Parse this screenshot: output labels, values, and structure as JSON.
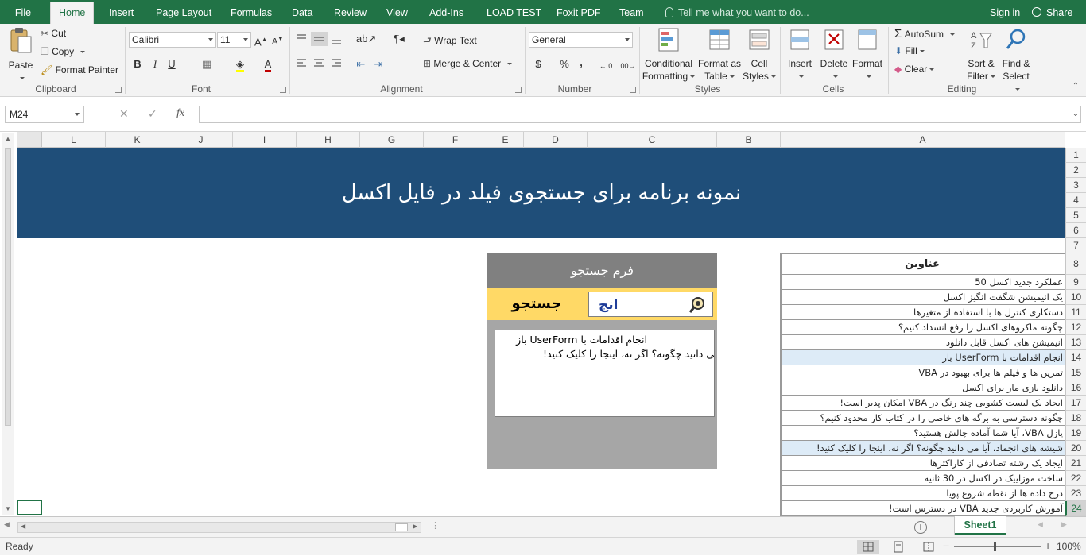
{
  "ribbon_tabs": [
    "File",
    "Home",
    "Insert",
    "Page Layout",
    "Formulas",
    "Data",
    "Review",
    "View",
    "Add-Ins",
    "LOAD TEST",
    "Foxit PDF",
    "Team"
  ],
  "tell_me": "Tell me what you want to do...",
  "sign_in": "Sign in",
  "share": "Share",
  "clipboard": {
    "paste": "Paste",
    "cut": "Cut",
    "copy": "Copy",
    "format_painter": "Format Painter",
    "label": "Clipboard"
  },
  "font": {
    "name": "Calibri",
    "size": "11",
    "bold": "B",
    "italic": "I",
    "underline": "U",
    "label": "Font"
  },
  "alignment": {
    "wrap_text": "Wrap Text",
    "merge_center": "Merge & Center",
    "label": "Alignment"
  },
  "number": {
    "format": "General",
    "currency": "$",
    "percent": "%",
    "comma": ",",
    "label": "Number"
  },
  "styles": {
    "conditional_formatting": [
      "Conditional",
      "Formatting"
    ],
    "format_as_table": [
      "Format as",
      "Table"
    ],
    "cell_styles": [
      "Cell",
      "Styles"
    ],
    "label": "Styles"
  },
  "cells": {
    "insert": "Insert",
    "delete": "Delete",
    "format": "Format",
    "label": "Cells"
  },
  "editing": {
    "autosum": "AutoSum",
    "fill": "Fill",
    "clear": "Clear",
    "sort_filter": [
      "Sort &",
      "Filter"
    ],
    "find_select": [
      "Find &",
      "Select"
    ],
    "label": "Editing"
  },
  "formula_bar": {
    "name_box": "M24",
    "cancel": "✕",
    "enter": "✓",
    "fx": "fx",
    "formula": ""
  },
  "columns": [
    "L",
    "K",
    "J",
    "I",
    "H",
    "G",
    "F",
    "E",
    "D",
    "C",
    "B",
    "A"
  ],
  "rows": [
    "1",
    "2",
    "3",
    "4",
    "5",
    "6",
    "7",
    "8",
    "9",
    "10",
    "11",
    "12",
    "13",
    "14",
    "15",
    "16",
    "17",
    "18",
    "19",
    "20",
    "21",
    "22",
    "23",
    "24"
  ],
  "selected_row": "24",
  "banner_title": "نمونه برنامه برای جستجوی فیلد در فایل اکسل",
  "titles_header": "عناوین",
  "titles": [
    "عملکرد جدید اکسل 50",
    "یک انیمیشن شگفت انگیز اکسل",
    "دستکاری کنترل ها با استفاده از متغیرها",
    "چگونه ماکروهای اکسل را رفع انسداد کنیم؟",
    "انیمیشن های اکسل قابل دانلود",
    "انجام اقدامات با UserForm باز",
    "تمرین ها و فیلم ها برای بهبود در VBA",
    "دانلود بازی مار برای اکسل",
    "ایجاد یک لیست کشویی چند رنگ در VBA امکان پذیر است!",
    "چگونه دسترسی به برگه های خاصی را در کتاب کار محدود کنیم؟",
    "پازل VBA، آیا شما آماده چالش هستید؟",
    "شیشه های انجماد، آیا می دانید چگونه؟ اگر نه، اینجا را کلیک کنید!",
    "ایجاد یک رشته تصادفی از کاراکترها",
    "ساخت موزاییک در اکسل در 30 ثانیه",
    "درج داده ها از نقطه شروع پویا",
    "آموزش کاربردی جدید VBA در دسترس است!"
  ],
  "highlighted_titles": [
    5,
    11
  ],
  "search_form": {
    "title": "فرم جستجو",
    "button": "جستجو",
    "query": "انج",
    "results": [
      "انجام اقدامات با UserForm باز",
      "شیشه های انجماد، آیا می دانید چگونه؟ اگر نه، اینجا را کلیک کنید!"
    ]
  },
  "sheet_tab": "Sheet1",
  "status": "Ready",
  "zoom": "100%",
  "colors": {
    "brand": "#217346",
    "banner": "#1f4e79",
    "form_header": "#808080",
    "form_body": "#a6a6a6",
    "search_row": "#ffd966",
    "highlight": "#ddebf7"
  }
}
